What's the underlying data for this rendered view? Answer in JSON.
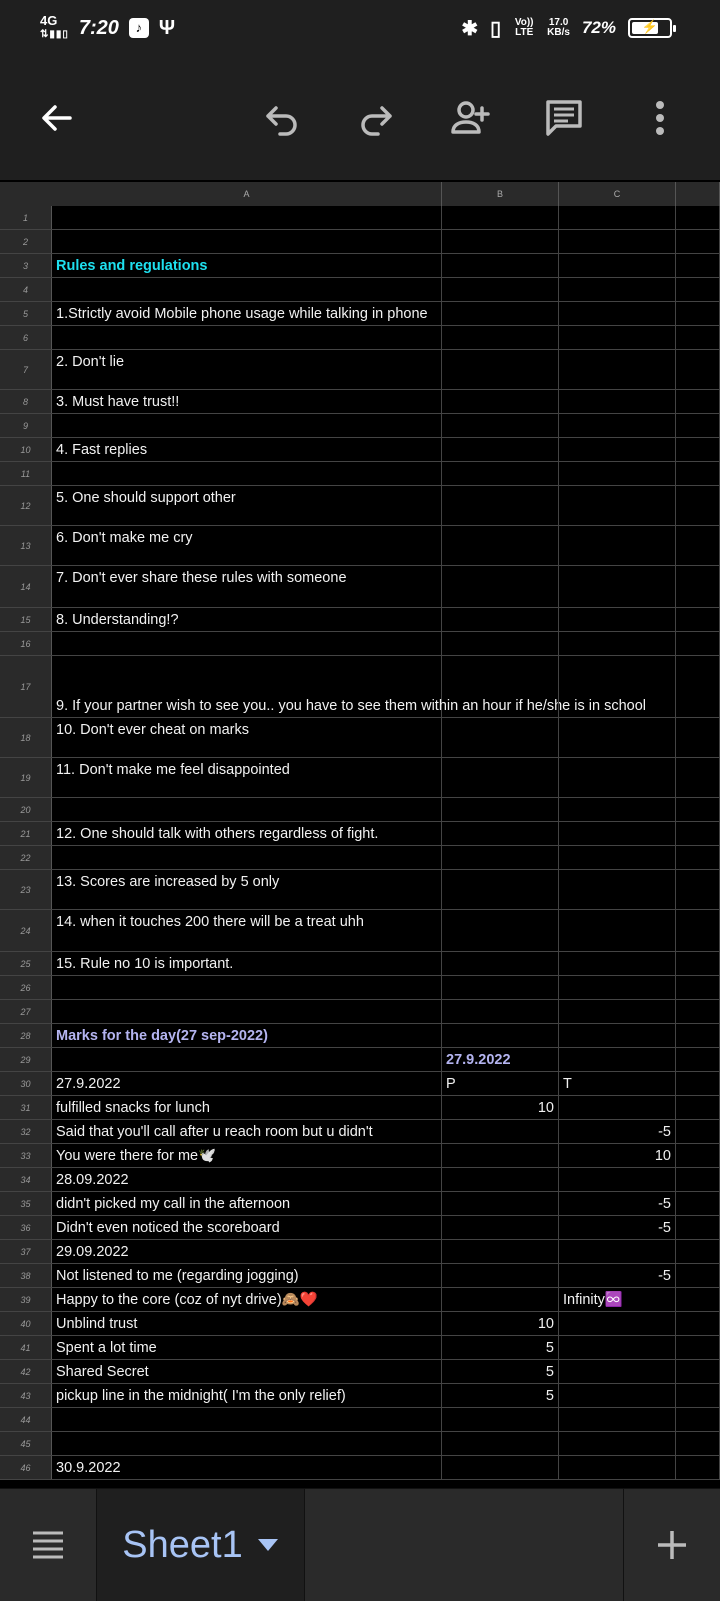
{
  "status_bar": {
    "network": "4G",
    "time": "7:20",
    "volte": "Vo)) LTE",
    "speed_value": "17.0",
    "speed_unit": "KB/s",
    "battery": "72%",
    "battery_level": 0.72
  },
  "toolbar": {
    "back": "back-arrow-icon",
    "undo": "undo-icon",
    "redo": "redo-icon",
    "share": "add-person-icon",
    "comment": "comment-icon",
    "more": "more-vert-icon"
  },
  "sheet": {
    "columns": [
      "A",
      "B",
      "C"
    ],
    "rows": [
      {
        "n": "1",
        "a": "",
        "b": "",
        "c": ""
      },
      {
        "n": "2",
        "a": "",
        "b": "",
        "c": ""
      },
      {
        "n": "3",
        "a": "Rules and regulations",
        "b": "",
        "c": ""
      },
      {
        "n": "4",
        "a": "",
        "b": "",
        "c": ""
      },
      {
        "n": "5",
        "a": "1.Strictly avoid Mobile phone usage while talking in phone",
        "b": "",
        "c": ""
      },
      {
        "n": "6",
        "a": "",
        "b": "",
        "c": ""
      },
      {
        "n": "7",
        "a": "2. Don't lie",
        "b": "",
        "c": ""
      },
      {
        "n": "8",
        "a": "3. Must have trust!!",
        "b": "",
        "c": ""
      },
      {
        "n": "9",
        "a": "",
        "b": "",
        "c": ""
      },
      {
        "n": "10",
        "a": "4. Fast replies",
        "b": "",
        "c": ""
      },
      {
        "n": "11",
        "a": "",
        "b": "",
        "c": ""
      },
      {
        "n": "12",
        "a": "5. One should support other",
        "b": "",
        "c": ""
      },
      {
        "n": "13",
        "a": "6. Don't make me cry",
        "b": "",
        "c": ""
      },
      {
        "n": "14",
        "a": "7. Don't ever share these rules with someone",
        "b": "",
        "c": ""
      },
      {
        "n": "15",
        "a": "8. Understanding!?",
        "b": "",
        "c": ""
      },
      {
        "n": "16",
        "a": "",
        "b": "",
        "c": ""
      },
      {
        "n": "17",
        "a": "9. If your partner wish to see you.. you have to see them within an hour if he/she is in school",
        "b": "",
        "c": ""
      },
      {
        "n": "18",
        "a": "10. Don't ever cheat on marks",
        "b": "",
        "c": ""
      },
      {
        "n": "19",
        "a": "11. Don't make me feel disappointed",
        "b": "",
        "c": ""
      },
      {
        "n": "20",
        "a": "",
        "b": "",
        "c": ""
      },
      {
        "n": "21",
        "a": "12. One should talk with others regardless of fight.",
        "b": "",
        "c": ""
      },
      {
        "n": "22",
        "a": "",
        "b": "",
        "c": ""
      },
      {
        "n": "23",
        "a": "13. Scores are increased by 5 only",
        "b": "",
        "c": ""
      },
      {
        "n": "24",
        "a": "14. when it touches 200 there will be a treat uhh",
        "b": "",
        "c": ""
      },
      {
        "n": "25",
        "a": "15. Rule no 10 is important.",
        "b": "",
        "c": ""
      },
      {
        "n": "26",
        "a": "",
        "b": "",
        "c": ""
      },
      {
        "n": "27",
        "a": "",
        "b": "",
        "c": ""
      },
      {
        "n": "28",
        "a": "Marks for the day(27 sep-2022)",
        "b": "",
        "c": ""
      },
      {
        "n": "29",
        "a": "",
        "b": "27.9.2022",
        "c": ""
      },
      {
        "n": "30",
        "a": "27.9.2022",
        "b": "P",
        "c": "T"
      },
      {
        "n": "31",
        "a": "fulfilled snacks for lunch",
        "b": "10",
        "c": ""
      },
      {
        "n": "32",
        "a": "Said that you'll call after u reach room but u didn't",
        "b": "",
        "c": "-5"
      },
      {
        "n": "33",
        "a": "You were there for me🕊️",
        "b": "",
        "c": "10"
      },
      {
        "n": "34",
        "a": "28.09.2022",
        "b": "",
        "c": ""
      },
      {
        "n": "35",
        "a": "didn't picked my call in the afternoon",
        "b": "",
        "c": "-5"
      },
      {
        "n": "36",
        "a": "Didn't even noticed the scoreboard",
        "b": "",
        "c": "-5"
      },
      {
        "n": "37",
        "a": "29.09.2022",
        "b": "",
        "c": ""
      },
      {
        "n": "38",
        "a": "Not listened to me (regarding jogging)",
        "b": "",
        "c": "-5"
      },
      {
        "n": "39",
        "a": "Happy to the core (coz of nyt drive)🙈❤️",
        "b": "",
        "c": "Infinity♾️"
      },
      {
        "n": "40",
        "a": "Unblind trust",
        "b": "10",
        "c": ""
      },
      {
        "n": "41",
        "a": "Spent a lot time",
        "b": "5",
        "c": ""
      },
      {
        "n": "42",
        "a": "Shared Secret",
        "b": "5",
        "c": ""
      },
      {
        "n": "43",
        "a": "pickup line in the midnight( I'm the only relief)",
        "b": "5",
        "c": ""
      },
      {
        "n": "44",
        "a": "",
        "b": "",
        "c": ""
      },
      {
        "n": "45",
        "a": "",
        "b": "",
        "c": ""
      },
      {
        "n": "46",
        "a": "30.9.2022",
        "b": "",
        "c": ""
      }
    ]
  },
  "bottom": {
    "sheet_tab": "Sheet1"
  }
}
